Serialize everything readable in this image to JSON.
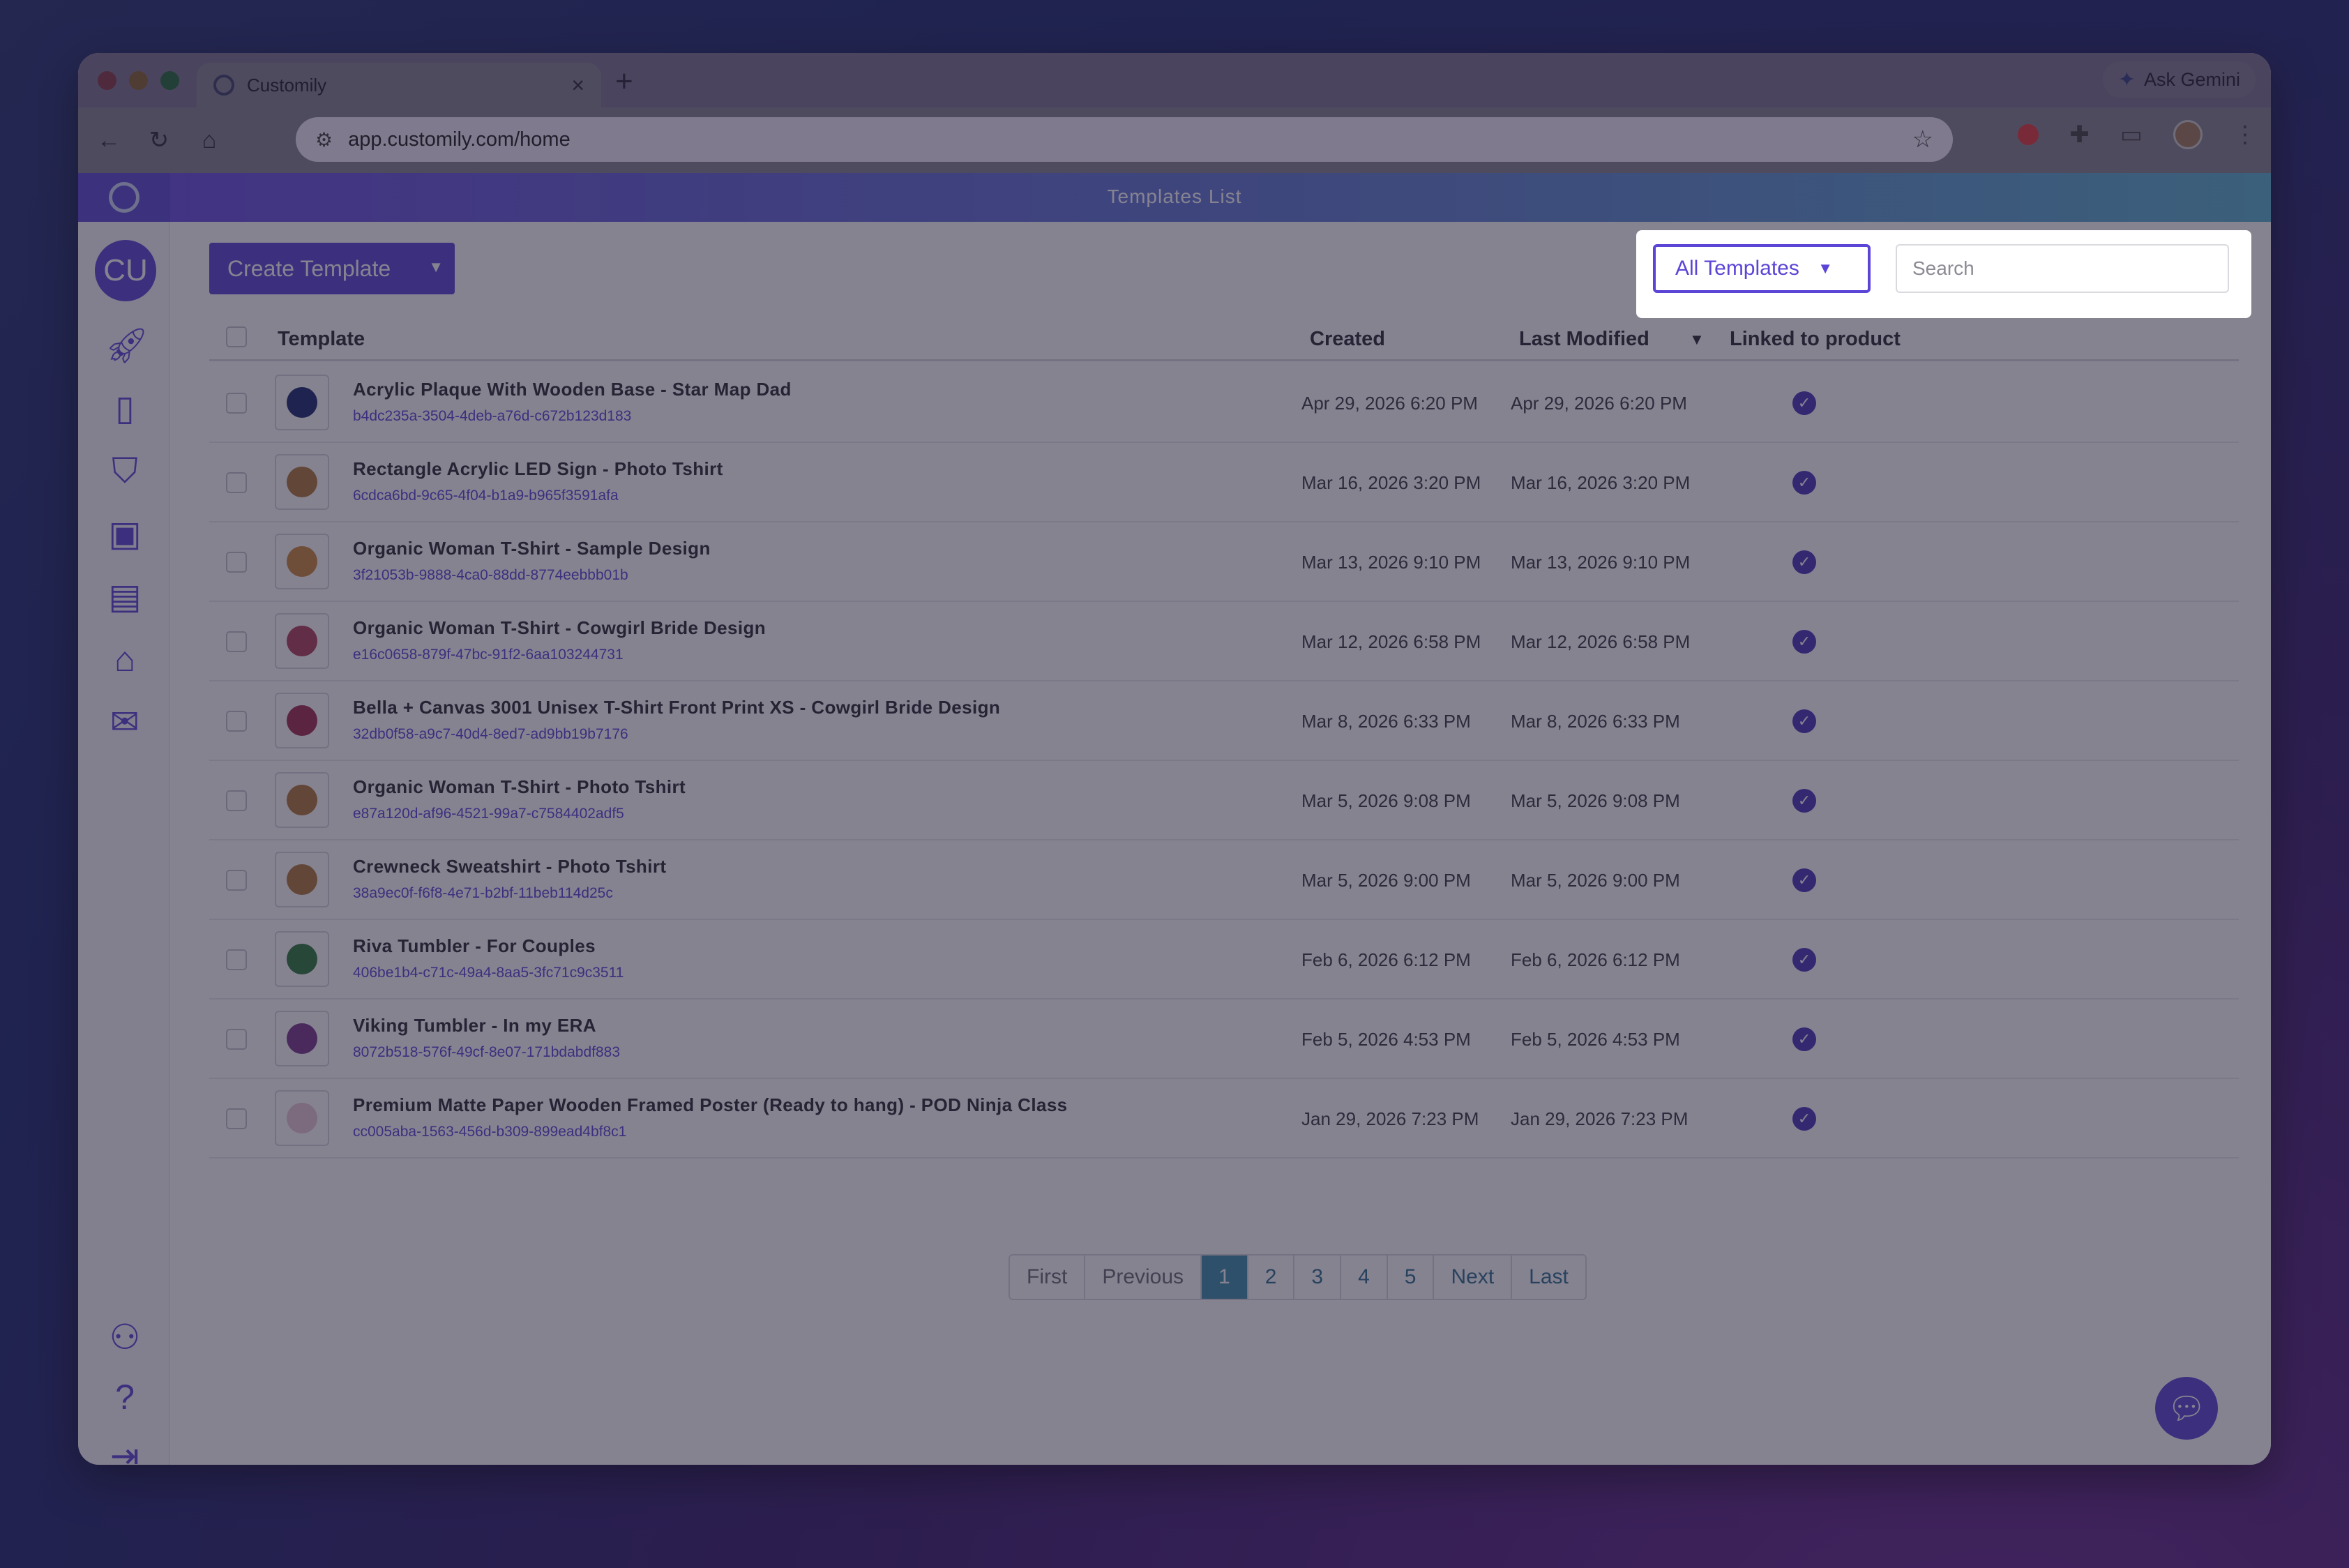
{
  "browser": {
    "tab_title": "Customily",
    "tab_close": "×",
    "new_tab": "+",
    "ask_gemini": "Ask Gemini",
    "url": "app.customily.com/home",
    "icons": [
      "back-icon",
      "forward-icon",
      "reload-icon",
      "home-icon",
      "site-settings-icon",
      "bookmark-star-icon",
      "extension-icon",
      "puzzle-icon",
      "cast-icon",
      "profile-avatar",
      "kebab-menu-icon"
    ]
  },
  "header": {
    "title": "Templates List"
  },
  "sidebar": {
    "avatar": "CU",
    "items": [
      "rocket-icon",
      "document-icon",
      "tshirt-icon",
      "monitor-templates-icon",
      "book-icon",
      "store-icon",
      "inbox-icon",
      "user-settings-icon",
      "help-icon",
      "logout-icon"
    ]
  },
  "toolbar": {
    "create_label": "Create Template",
    "filter_label": "All Templates",
    "search_placeholder": "Search"
  },
  "table": {
    "columns": {
      "template": "Template",
      "created": "Created",
      "modified": "Last Modified",
      "linked": "Linked to product"
    },
    "rows": [
      {
        "name": "Acrylic Plaque With Wooden Base - Star Map Dad",
        "id": "b4dc235a-3504-4deb-a76d-c672b123d183",
        "created": "Apr 29, 2026 6:20 PM",
        "modified": "Apr 29, 2026 6:20 PM",
        "linked": true
      },
      {
        "name": "Rectangle Acrylic LED Sign - Photo Tshirt",
        "id": "6cdca6bd-9c65-4f04-b1a9-b965f3591afa",
        "created": "Mar 16, 2026 3:20 PM",
        "modified": "Mar 16, 2026 3:20 PM",
        "linked": true
      },
      {
        "name": "Organic Woman T-Shirt - Sample Design",
        "id": "3f21053b-9888-4ca0-88dd-8774eebbb01b",
        "created": "Mar 13, 2026 9:10 PM",
        "modified": "Mar 13, 2026 9:10 PM",
        "linked": true
      },
      {
        "name": "Organic Woman T-Shirt - Cowgirl Bride Design",
        "id": "e16c0658-879f-47bc-91f2-6aa103244731",
        "created": "Mar 12, 2026 6:58 PM",
        "modified": "Mar 12, 2026 6:58 PM",
        "linked": true
      },
      {
        "name": "Bella + Canvas 3001 Unisex T-Shirt Front Print XS - Cowgirl Bride Design",
        "id": "32db0f58-a9c7-40d4-8ed7-ad9bb19b7176",
        "created": "Mar 8, 2026 6:33 PM",
        "modified": "Mar 8, 2026 6:33 PM",
        "linked": true
      },
      {
        "name": "Organic Woman T-Shirt - Photo Tshirt",
        "id": "e87a120d-af96-4521-99a7-c7584402adf5",
        "created": "Mar 5, 2026 9:08 PM",
        "modified": "Mar 5, 2026 9:08 PM",
        "linked": true
      },
      {
        "name": "Crewneck Sweatshirt - Photo Tshirt",
        "id": "38a9ec0f-f6f8-4e71-b2bf-11beb114d25c",
        "created": "Mar 5, 2026 9:00 PM",
        "modified": "Mar 5, 2026 9:00 PM",
        "linked": true
      },
      {
        "name": "Riva Tumbler - For Couples",
        "id": "406be1b4-c71c-49a4-8aa5-3fc71c9c3511",
        "created": "Feb 6, 2026 6:12 PM",
        "modified": "Feb 6, 2026 6:12 PM",
        "linked": true
      },
      {
        "name": "Viking Tumbler - In my ERA",
        "id": "8072b518-576f-49cf-8e07-171bdabdf883",
        "created": "Feb 5, 2026 4:53 PM",
        "modified": "Feb 5, 2026 4:53 PM",
        "linked": true
      },
      {
        "name": "Premium Matte Paper Wooden Framed Poster (Ready to hang) - POD Ninja Class",
        "id": "cc005aba-1563-456d-b309-899ead4bf8c1",
        "created": "Jan 29, 2026 7:23 PM",
        "modified": "Jan 29, 2026 7:23 PM",
        "linked": true
      }
    ]
  },
  "pagination": {
    "first": "First",
    "previous": "Previous",
    "pages": [
      "1",
      "2",
      "3",
      "4",
      "5"
    ],
    "current": "1",
    "next": "Next",
    "last": "Last"
  },
  "colors": {
    "accent": "#5b45d6",
    "header_gradient_start": "#6a4be0",
    "header_gradient_end": "#5ab2cf",
    "active_page": "#3f8ea8"
  }
}
